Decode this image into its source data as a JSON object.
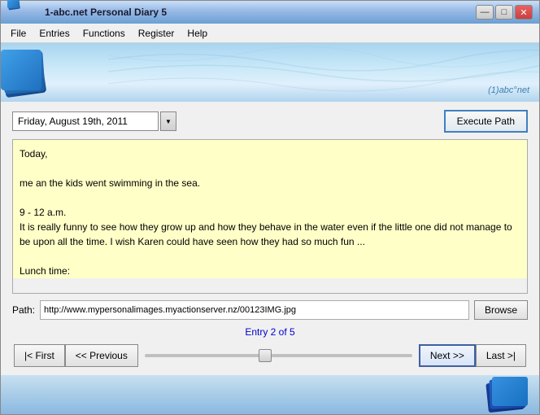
{
  "window": {
    "title": "1-abc.net Personal Diary 5",
    "brand": "(1)abc°net"
  },
  "titlebar_buttons": {
    "minimize": "—",
    "restore": "□",
    "close": "✕"
  },
  "menu": {
    "items": [
      {
        "id": "file",
        "label": "File"
      },
      {
        "id": "entries",
        "label": "Entries"
      },
      {
        "id": "functions",
        "label": "Functions"
      },
      {
        "id": "register",
        "label": "Register"
      },
      {
        "id": "help",
        "label": "Help"
      }
    ]
  },
  "toolbar": {
    "date_value": "Friday, August 19th, 2011",
    "execute_btn_label": "Execute Path"
  },
  "diary": {
    "content": "Today,\n\nme an the kids went swimming in the sea.\n\n9 - 12 a.m.\nIt is really funny to see how they grow up and how they behave in the water even if the little one did not manage to be upon all the time. I wish Karen could have seen how they had so much fun ...\n\nLunch time:\nToday it was on Kevin to decide where to go too lunch so we had to eat the same as he always wants - Boston Cream Donuts."
  },
  "path_row": {
    "label": "Path:",
    "value": "http://www.mypersonalimages.myactionserver.nz/00123IMG.jpg",
    "browse_label": "Browse"
  },
  "entry_info": {
    "text": "Entry 2 of 5"
  },
  "navigation": {
    "first_label": "|< First",
    "prev_label": "<< Previous",
    "next_label": "Next >>",
    "last_label": "Last >|"
  }
}
